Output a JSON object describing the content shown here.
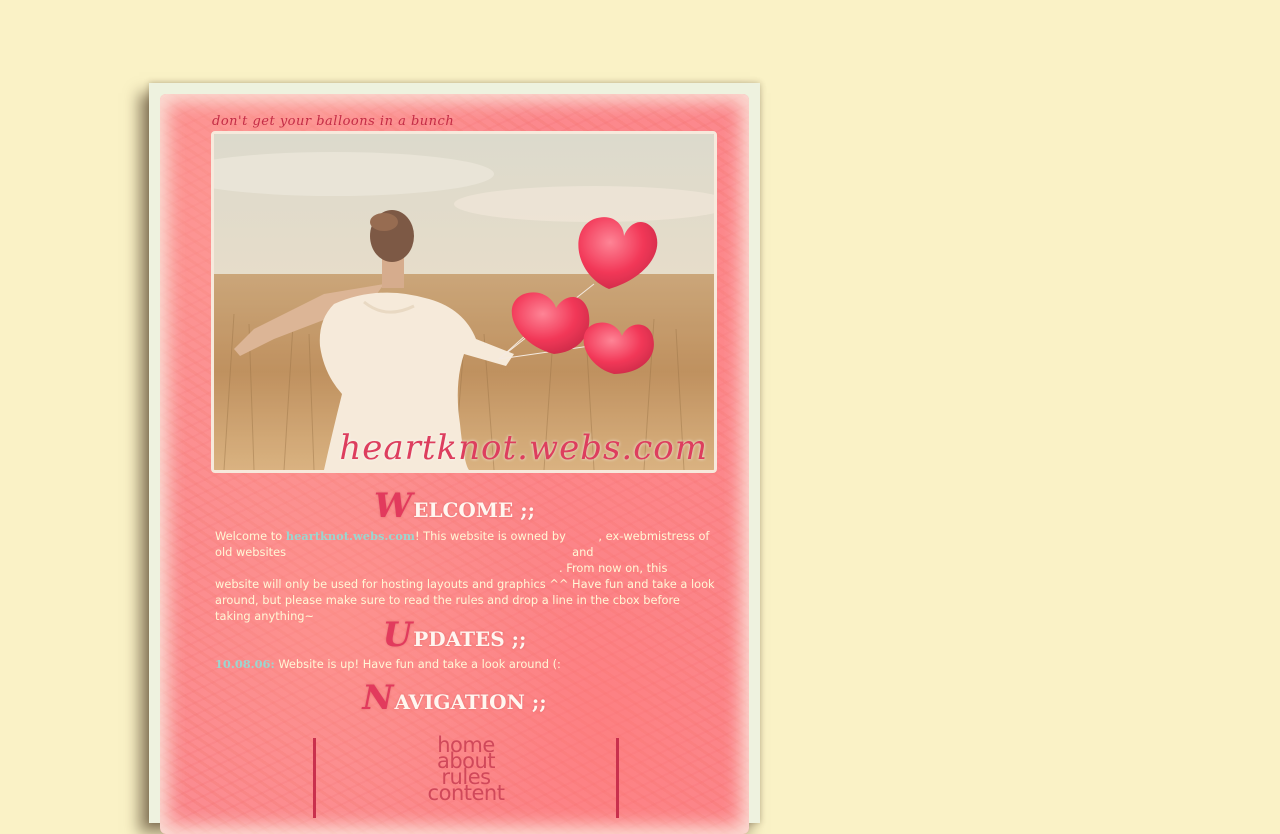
{
  "site": {
    "tagline": "don't get your balloons in a bunch",
    "name": "heartknot.webs.com"
  },
  "welcome": {
    "heading_initial": "W",
    "heading_rest": "ELCOME ;;",
    "text_1": "Welcome to ",
    "site_link": "heartknot.webs.com",
    "text_2": "! This website is owned by ",
    "text_3": ", ex-webmistress of old websites ",
    "text_4": " and ",
    "text_5": ". From now on, this website will only be used for hosting layouts and graphics ^^ Have fun and take a look around, but please make sure to read the rules and drop a line in the cbox before taking anything~"
  },
  "updates": {
    "heading_initial": "U",
    "heading_rest": "PDATES ;;",
    "entries": [
      {
        "date": "10.08.06:",
        "text": " Website is up! Have fun and take a look around (:"
      }
    ]
  },
  "navigation": {
    "heading_initial": "N",
    "heading_rest": "AVIGATION ;;",
    "items": [
      "home",
      "about",
      "rules",
      "content"
    ]
  },
  "colors": {
    "background": "#faf2c6",
    "panel_pink": "#fb8a90",
    "heading_accent": "#e23a5d",
    "link_teal": "#9bd6d0",
    "body_text": "#fff7d6"
  }
}
